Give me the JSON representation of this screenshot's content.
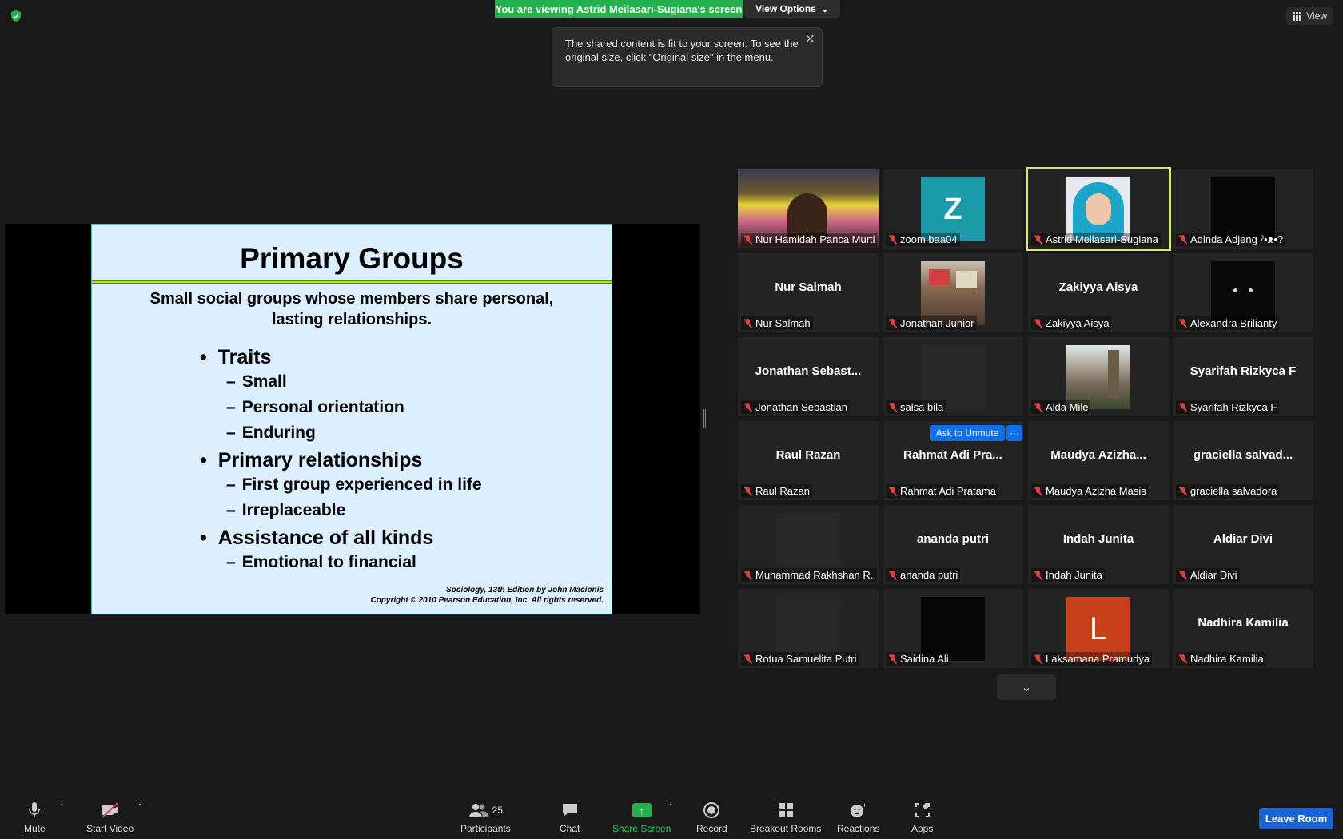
{
  "top": {
    "viewing_banner": "You are viewing Astrid Meilasari-Sugiana's screen",
    "view_options": "View Options",
    "view_button": "View"
  },
  "tooltip": {
    "text": "The shared content is fit to your screen. To see the original size, click \"Original size\" in the menu."
  },
  "slide": {
    "title": "Primary Groups",
    "subtitle_line1": "Small social groups whose members share personal,",
    "subtitle_line2": "lasting relationships.",
    "bullets": [
      {
        "text": "Traits",
        "subs": [
          "Small",
          "Personal orientation",
          "Enduring"
        ]
      },
      {
        "text": "Primary relationships",
        "subs": [
          "First group experienced in life",
          "Irreplaceable"
        ]
      },
      {
        "text": "Assistance of all kinds",
        "subs": [
          "Emotional to financial"
        ]
      }
    ],
    "footer_line1": "Sociology, 13th Edition by John Macionis",
    "footer_line2": "Copyright © 2010 Pearson Education, Inc.  All rights reserved."
  },
  "participants": [
    {
      "name": "Nur Hamidah Panca Murti",
      "big": "",
      "pic": "video-feed"
    },
    {
      "name": "zoom baa04",
      "big": "",
      "pic": "avatar-z"
    },
    {
      "name": "Astrid Meilasari-Sugiana",
      "big": "",
      "pic": "video-feed-speaker"
    },
    {
      "name": "Adinda Adjeng ˀ•ᴥ•?",
      "big": "",
      "pic": "dark"
    },
    {
      "name": "Nur Salmah",
      "big": "Nur Salmah",
      "pic": ""
    },
    {
      "name": "Jonathan Junior",
      "big": "",
      "pic": "video-room"
    },
    {
      "name": "Zakiyya Aisya",
      "big": "Zakiyya Aisya",
      "pic": ""
    },
    {
      "name": "Alexandra Brilianty",
      "big": "",
      "pic": "cat-photo"
    },
    {
      "name": "Jonathan Sebastian",
      "big": "Jonathan  Sebast...",
      "pic": ""
    },
    {
      "name": "salsa bila",
      "big": "",
      "pic": "dim"
    },
    {
      "name": "Alda Mile",
      "big": "",
      "pic": "building-photo"
    },
    {
      "name": "Syarifah Rizkyca F",
      "big": "Syarifah Rizkyca F",
      "pic": ""
    },
    {
      "name": "Raul Razan",
      "big": "Raul Razan",
      "pic": ""
    },
    {
      "name": "Rahmat Adi Pratama",
      "big": "Rahmat Adi Pra...",
      "pic": ""
    },
    {
      "name": "Maudya Azizha Masis",
      "big": "Maudya  Azizha...",
      "pic": ""
    },
    {
      "name": "graciella salvadora",
      "big": "graciella  salvad...",
      "pic": ""
    },
    {
      "name": "Muhammad Rakhshan R...",
      "big": "",
      "pic": "dim"
    },
    {
      "name": "ananda putri",
      "big": "ananda putri",
      "pic": ""
    },
    {
      "name": "Indah Junita",
      "big": "Indah Junita",
      "pic": ""
    },
    {
      "name": "Aldiar Divi",
      "big": "Aldiar Divi",
      "pic": ""
    },
    {
      "name": "Rotua Samuelita Putri",
      "big": "",
      "pic": "dim"
    },
    {
      "name": "Saidina Ali",
      "big": "",
      "pic": "dark"
    },
    {
      "name": "Laksamana Pramudya",
      "big": "",
      "pic": "avatar-l"
    },
    {
      "name": "Nadhira Kamilia",
      "big": "Nadhira Kamilia",
      "pic": ""
    }
  ],
  "hover": {
    "ask_unmute": "Ask to Unmute",
    "more": "···"
  },
  "avatars": {
    "z_letter": "Z",
    "z_color": "#1b9aaa",
    "l_letter": "L",
    "l_color": "#c8401a"
  },
  "toolbar": {
    "mute": "Mute",
    "start_video": "Start Video",
    "participants": "Participants",
    "participant_count": "25",
    "chat": "Chat",
    "share_screen": "Share Screen",
    "record": "Record",
    "breakout_rooms": "Breakout Rooms",
    "reactions": "Reactions",
    "apps": "Apps",
    "leave": "Leave Room"
  }
}
